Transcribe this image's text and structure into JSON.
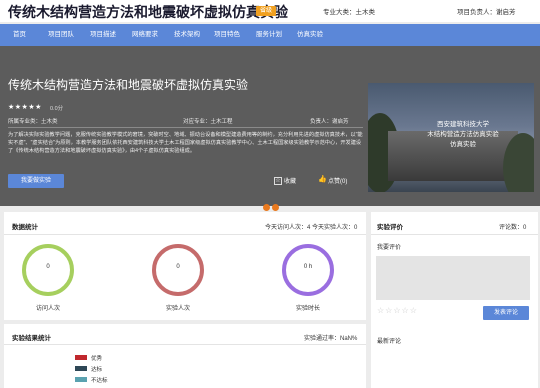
{
  "header": {
    "site_title": "传统木结构营造方法和地震破坏虚拟仿真实验",
    "badge": "省级",
    "category_label": "专业大类：土木类",
    "leader_label": "项目负责人：谢启芳"
  },
  "nav": {
    "items": [
      "首页",
      "项目团队",
      "项目描述",
      "网络要求",
      "技术架构",
      "项目特色",
      "服务计划",
      "仿真实验"
    ]
  },
  "hero": {
    "title": "传统木结构营造方法和地震破坏虚拟仿真实验",
    "stars": "★★★★★",
    "score": "0.0分",
    "major": "所属专业类：土木类",
    "target_major": "对应专业：土木工程",
    "leader": "负责人：谢启芳",
    "description": "为了解决实际实验教学问题，克服传统实验教学模式的窘境，突破时空、地域、振动台设备和模型建造费用等的制约，充分利用先进的虚拟仿真技术，以\"能实不虚\"、\"虚实结合\"为原则，本教学服务团队依托西安建筑科技大学土木工程国家级虚拟仿真实验教学中心、土木工程国家级实验教学示范中心，开发建设了《传统木结构营造方法和地震破坏虚拟仿真实验》，由4个子虚拟仿真实验组成。",
    "start_button": "我要做实验",
    "favorite": "收藏",
    "like": "点赞(0)",
    "image_caption_line1": "西安建筑科技大学",
    "image_caption_line2": "木结构营造方法仿真实验",
    "image_caption_line3": "仿真实验"
  },
  "stats": {
    "title": "数据统计",
    "today": "今天访问人次：4 今天实验人次：0",
    "rings": [
      {
        "value": "0",
        "label": "访问人次",
        "color": "#a6cf5e"
      },
      {
        "value": "0",
        "label": "实验人次",
        "color": "#c56b6b"
      },
      {
        "value": "0 h",
        "label": "实验时长",
        "color": "#9a6ee0"
      }
    ]
  },
  "results": {
    "title": "实验结果统计",
    "pass_rate": "实验通过率：NaN%",
    "legend": [
      {
        "label": "优秀",
        "color": "#c0282d"
      },
      {
        "label": "达标",
        "color": "#2e4756"
      },
      {
        "label": "不达标",
        "color": "#5aa2b0"
      }
    ]
  },
  "review": {
    "title": "实验评价",
    "count": "评论数：0",
    "my_review": "我要评价",
    "rate_stars": "☆☆☆☆☆",
    "submit": "发表评论",
    "latest": "最新评论"
  }
}
